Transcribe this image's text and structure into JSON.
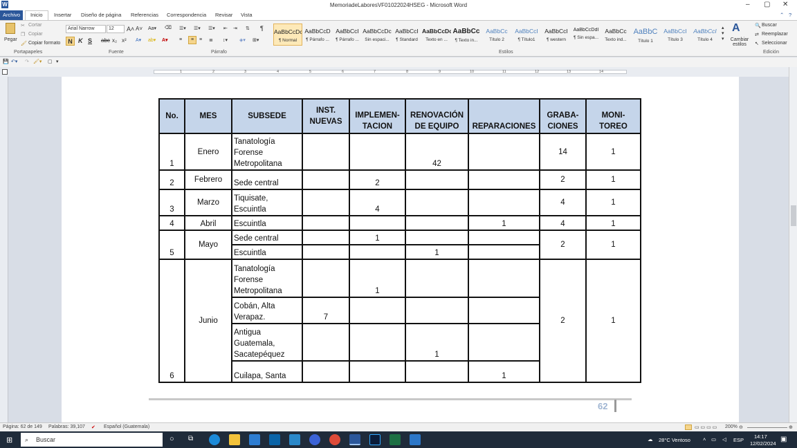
{
  "window": {
    "title": "MemoriadeLaboresVF01022024HSEG  -  Microsoft Word",
    "app_logo": "W",
    "controls": [
      "–",
      "▢",
      "✕"
    ]
  },
  "ribbon_tabs": [
    "Archivo",
    "Inicio",
    "Insertar",
    "Diseño de página",
    "Referencias",
    "Correspondencia",
    "Revisar",
    "Vista"
  ],
  "clipboard": {
    "paste": "Pegar",
    "cut": "Cortar",
    "copy": "Copiar",
    "format_painter": "Copiar formato",
    "group": "Portapapeles"
  },
  "font": {
    "name": "Arial Narrow",
    "size": "12",
    "group": "Fuente"
  },
  "paragraph": {
    "group": "Párrafo"
  },
  "styles": {
    "group": "Estilos",
    "items": [
      {
        "preview": "AaBbCcDc",
        "name": "¶ Normal"
      },
      {
        "preview": "AaBbCcD",
        "name": "¶ Párrafo ..."
      },
      {
        "preview": "AaBbCcI",
        "name": "¶ Párrafo ..."
      },
      {
        "preview": "AaBbCcDc",
        "name": "Sin espaci..."
      },
      {
        "preview": "AaBbCcI",
        "name": "¶ Standard"
      },
      {
        "preview": "AaBbCcDc",
        "name": "Texto en ..."
      },
      {
        "preview": "AaBbCc",
        "name": "¶ Texto in..."
      },
      {
        "preview": "AaBbCc",
        "name": "Título 2"
      },
      {
        "preview": "AaBbCcI",
        "name": "¶ Título1"
      },
      {
        "preview": "AaBbCcI",
        "name": "¶ western"
      },
      {
        "preview": "AaBbCcDdI",
        "name": "¶ Sin espa..."
      },
      {
        "preview": "AaBbCc",
        "name": "Texto ind..."
      },
      {
        "preview": "AaBbC",
        "name": "Título 1"
      },
      {
        "preview": "AaBbCcI",
        "name": "Título 3"
      },
      {
        "preview": "AaBbCcI",
        "name": "Título 4"
      }
    ],
    "change": "Cambiar estilos"
  },
  "editing": {
    "find": "Buscar",
    "replace": "Reemplazar",
    "select": "Seleccionar",
    "group": "Edición"
  },
  "ruler_marks": [
    "1",
    "2",
    "3",
    "4",
    "5",
    "6",
    "7",
    "8",
    "9",
    "10",
    "11",
    "12",
    "13",
    "14",
    "15"
  ],
  "table": {
    "headers": [
      "No.",
      "MES",
      "SUBSEDE",
      "INST. NUEVAS",
      "IMPLEMEN- TACION",
      "RENOVACIÓN DE EQUIPO",
      "REPARACIONES",
      "GRABA- CIONES",
      "MONI- TOREO"
    ],
    "rows": {
      "r1": {
        "no": "1",
        "mes": "Enero",
        "subsede": "Tanatología Forense Metropolitana",
        "inst": "",
        "impl": "",
        "renov": "42",
        "repar": "",
        "grab": "14",
        "moni": "1"
      },
      "r2": {
        "no": "2",
        "mes": "Febrero",
        "subsede": "Sede central",
        "inst": "",
        "impl": "2",
        "renov": "",
        "repar": "",
        "grab": "2",
        "moni": "1"
      },
      "r3": {
        "no": "3",
        "mes": "Marzo",
        "subsede": "Tiquisate, Escuintla",
        "inst": "",
        "impl": "4",
        "renov": "",
        "repar": "",
        "grab": "4",
        "moni": "1"
      },
      "r4": {
        "no": "4",
        "mes": "Abril",
        "subsede": "Escuintla",
        "inst": "",
        "impl": "",
        "renov": "",
        "repar": "1",
        "grab": "4",
        "moni": "1"
      },
      "r5a": {
        "no": "5",
        "mes": "Mayo",
        "subsede": "Sede central",
        "inst": "",
        "impl": "1",
        "renov": "",
        "repar": "",
        "grab": "2",
        "moni": "1"
      },
      "r5b": {
        "subsede": "Escuintla",
        "inst": "",
        "impl": "",
        "renov": "1",
        "repar": ""
      },
      "r6a": {
        "no": "6",
        "mes": "Junio",
        "subsede": "Tanatología Forense Metropolitana",
        "inst": "",
        "impl": "1",
        "renov": "",
        "repar": "",
        "grab": "2",
        "moni": "1"
      },
      "r6b": {
        "subsede": "Cobán, Alta Verapaz.",
        "inst": "7",
        "impl": "",
        "renov": "",
        "repar": ""
      },
      "r6c": {
        "subsede": "Antigua Guatemala, Sacatepéquez",
        "inst": "",
        "impl": "",
        "renov": "1",
        "repar": ""
      },
      "r6d": {
        "subsede": "Cuilapa, Santa",
        "inst": "",
        "impl": "",
        "renov": "",
        "repar": "1"
      }
    }
  },
  "page_number": "62",
  "status": {
    "page": "Página: 62 de 149",
    "words": "Palabras: 39,107",
    "language": "Español (Guatemala)",
    "zoom": "200%"
  },
  "taskbar": {
    "search": "Buscar",
    "weather": "28°C  Ventoso",
    "lang": "ESP",
    "time": "14:17",
    "date": "12/02/2024"
  }
}
